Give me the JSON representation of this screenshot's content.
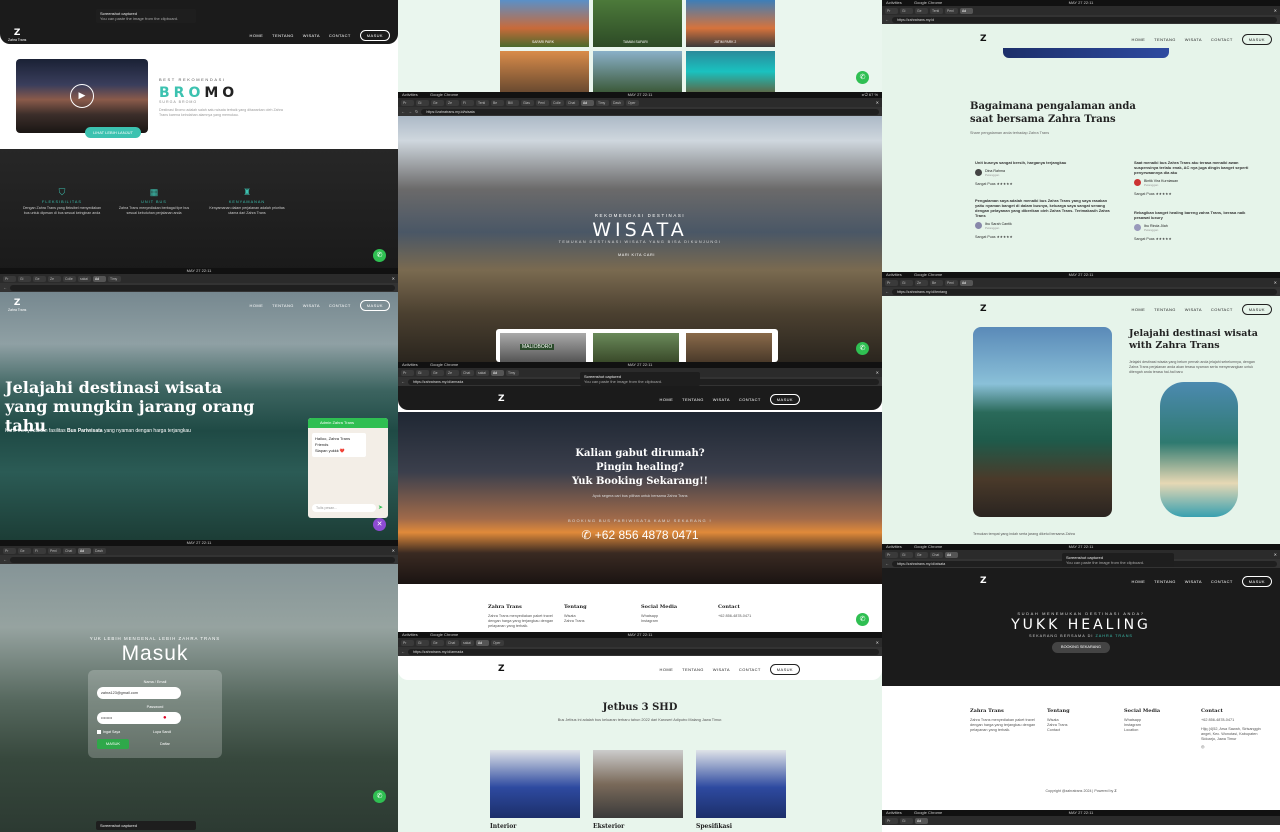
{
  "panel_1": {
    "toast": {
      "title": "Screenshot captured",
      "msg": "You can paste the image from the clipboard."
    },
    "nav": {
      "brand": "Zahra Trans",
      "items": [
        "HOME",
        "TENTANG",
        "WISATA",
        "CONTACT"
      ],
      "cta": "MASUK"
    },
    "hero": {
      "kicker": "BEST REKOMENDASI",
      "title_a": "BRO",
      "title_b": "MO",
      "sub": "SURGA BROMO",
      "desc": "Destinasi Bromo adalah salah satu wisata terbaik yang ditawarkan oleh Zahra Trans karena keindahan alamnya yang memukau.",
      "button": "LIHAT LEBIH LANJUT"
    },
    "features": [
      {
        "title": "FLEKSIBILITAS",
        "text": "Dengan Zahra Trans yang fleksibel menyediakan bus untuk dipesan di bus sesuai keinginan anda"
      },
      {
        "title": "UNIT BUS",
        "text": "Zahra Trans menyediakan berbagai tipe bus sesuai kebutuhan perjalanan anda"
      },
      {
        "title": "KENYAMANAN",
        "text": "Kenyamanan dalam perjalanan adalah prioritas utama dari Zahra Trans"
      }
    ],
    "clock": "MAY 27  22:11"
  },
  "panel_2": {
    "nav": {
      "brand": "Zahra Trans",
      "items": [
        "HOME",
        "TENTANG",
        "WISATA",
        "CONTACT"
      ],
      "cta": "MASUK"
    },
    "headline": "Jelajahi destinasi wisata yang mungkin jarang orang tahu",
    "sub_a": "Kami menyediakan fasilitas ",
    "sub_b": "Bus Pariwisata",
    "sub_c": " yang nyaman dengan harga terjangkau",
    "chat": {
      "header": "Admin Zahra Trans",
      "msg1": "Halloo, Zahra Trans Friends",
      "msg2": "Siapan yukkk ❤️",
      "input": "Tulis pesan..."
    }
  },
  "panel_3": {
    "kicker": "YUK LEBIH MENGENAL LEBIH ZAHRA TRANS",
    "title": "Masuk",
    "email_label": "Nama / Email",
    "email_value": "zahra123@gmail.com",
    "pass_label": "Password",
    "pass_value": "••••••••",
    "remember": "Ingat Saya",
    "forgot": "Lupa Sandi",
    "submit": "MASUK",
    "register": "Daftar",
    "toast": {
      "title": "Screenshot captured",
      "msg": "You can paste the image from the clipboard."
    }
  },
  "panel_4": {
    "tiles": [
      {
        "label": "SAFARI PARK"
      },
      {
        "label": "TAMAN SAFARI"
      },
      {
        "label": "JATIM PARK 2"
      },
      {
        "label": ""
      },
      {
        "label": ""
      },
      {
        "label": ""
      }
    ]
  },
  "panel_5": {
    "url": "https://zahratrans.my.id/wisata",
    "kicker": "REKOMENDASI DESTINASI",
    "title": "WISATA",
    "sub": "TEMUKAN DESTINASI WISATA YANG BISA DIKUNJUNGI",
    "button": "MARI KITA CARI",
    "thumb_label": "MALIOBORO"
  },
  "panel_6": {
    "url": "https://zahratrans.my.id/armada",
    "toast": {
      "title": "Screenshot captured",
      "msg": "You can paste the image from the clipboard."
    },
    "lines": [
      "Kalian gabut dirumah?",
      "Pingin healing?",
      "Yuk Booking Sekarang!!"
    ],
    "sub": "Ayok segera cari bus pilihan untuk bersama Zahra Trans",
    "kicker": "BOOKING BUS PARIWISATA KAMU SEKARANG !",
    "phone": "+62 856 4878 0471",
    "footer": {
      "c1": "Zahra Trans",
      "c1t": "Zahra Trans menyediakan paket travel dengan harga yang terjangkau dengan pelayanan yang terbaik.",
      "c2": "Tentang",
      "c2t": [
        "Wisata",
        "Zahra Trans",
        "Contact"
      ],
      "c3": "Social Media",
      "c3t": [
        "Whatsapp",
        "Instagram"
      ],
      "c4": "Contact",
      "c4t": "+62 856-4878-0471"
    }
  },
  "panel_7": {
    "url": "https://zahratrans.my.id/armada",
    "title": "Jetbus 3 SHD",
    "desc": "Bus Jetbus ini adalah bus keluaran terbaru tahun 2022 dari Karoseri Adiputro Malang Jawa Timur.",
    "labels": [
      "Interior",
      "Eksterior",
      "Spesifikasi"
    ]
  },
  "panel_8": {
    "url": "https://zahratrans.my.id",
    "title": "Bagaimana pengalaman anda saat bersama Zahra Trans",
    "sub": "Share pengalaman anda terhadap Zahra Trans",
    "reviews": [
      {
        "text": "Unit busnya sangat bersih, harganya terjangkau",
        "name": "Dina Rahma",
        "role": "Pelanggan",
        "rating": "Sangat Puas ★★★★★"
      },
      {
        "text": "Saat menaiki bus Zahra Trans aku terasa menaiki awan suspensinya terlalu enak, AC nya juga dingin banget seperti penyewaannya dia aku",
        "name": "Bintik Vira Kurniawan",
        "role": "Pelanggan",
        "rating": "Sangat Puas ★★★★★"
      },
      {
        "text": "Pengalaman saya adalah menaiki bus Zahra Trans yang saya rasakan yaitu nyaman banget di dalam busnya, keluarga saya sangat senang dengan pelayanan yang diberikan oleh Zahra Trans. Terimakasih Zahra Trans",
        "name": "Ibu Sarah Cantik",
        "role": "Pelanggan",
        "rating": "Sangat Puas ★★★★★"
      },
      {
        "text": "Rekagikan banget healing bareng zahra Trans, berasa naik pesawat luxury",
        "name": "Ibu Rinda Jilah",
        "role": "Pelanggan",
        "rating": "Sangat Puas ★★★★★"
      }
    ]
  },
  "panel_9": {
    "url": "https://zahratrans.my.id/tentang",
    "title_a": "Jelajahi destinasi wisata with ",
    "title_b": "Zahra Trans",
    "desc": "Jelajahi destinasi wisata yang belum pernah anda jelajahi sebelumnya, dengan Zahra Trans perjalanan anda akan terasa nyaman serta menyenangkan untuk ditengah anda terasa hal-hal baru",
    "caption": "Temukan tempat yang indah serta jarang diketui bersama Zahra"
  },
  "panel_10": {
    "url": "https://zahratrans.my.id/wisata",
    "toast": {
      "title": "Screenshot captured",
      "msg": "You can paste the image from the clipboard."
    },
    "kicker": "SUDAH MENEMUKAN DESTINASI ANDA?",
    "title": "YUKK HEALING",
    "sub_a": "SEKARANG BERSAMA DI ",
    "sub_b": "ZAHRA TRANS",
    "button": "BOOKING SEKARANG",
    "footer": {
      "c1": "Zahra Trans",
      "c1t": "Zahra Trans menyediakan paket travel dengan harga yang terjangkau dengan pelayanan yang terbaik.",
      "c2": "Tentang",
      "c2t": [
        "Wisata",
        "Zahra Trans",
        "Contact"
      ],
      "c3": "Social Media",
      "c3t": [
        "Whatsapp",
        "Instagram",
        "Location"
      ],
      "c4": "Contact",
      "c4t": "+62 856-4878-0471",
      "c4a": "Hijq (4)52, Arsa Sawah, Sirisanggin anget, Kec. Wonotasi, Kabupaten Sidoarjo, Jawa Timur"
    },
    "copyright": "Copyright @zahratrans 2024 | Powered by"
  },
  "chrome": {
    "activities": "Activities",
    "browser": "Google Chrome",
    "clock": "MAY 27  22:11",
    "sys": "◂ ⏻ 67 %",
    "tabs": [
      "Pr",
      "Gi",
      "Ge",
      "Ze",
      "Fi",
      "Tenti",
      "Be",
      "Bill",
      "Glas",
      "Penl",
      "Colle",
      "Chat",
      "sakai",
      "Ad",
      "Timy",
      "Dash",
      "Oper"
    ]
  },
  "colors": {
    "teal": "#3cc2b0",
    "whatsapp": "#2fbf52",
    "mint": "#e6f4ea",
    "dark": "#1d1d1d"
  }
}
